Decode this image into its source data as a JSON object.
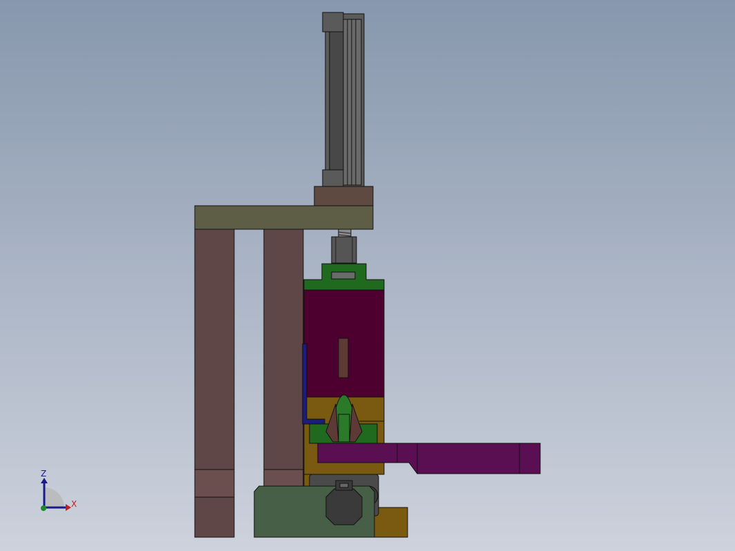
{
  "viewport": {
    "background_top": "#8797ad",
    "background_bottom": "#cdd2dc"
  },
  "triad": {
    "z_label": "Z",
    "x_label": "X",
    "z_color": "#1a1a8c",
    "x_color": "#c02020",
    "y_color": "#1f8a2a"
  },
  "parts": {
    "cylinder_color": "#5d5d5d",
    "top_plate_color": "#5e5e46",
    "pillar_color": "#5e4746",
    "upper_block_color": "#4d0030",
    "green_cap_color": "#1f6a1f",
    "lower_body_color": "#7a5a10",
    "arm_color": "#5a0f52",
    "base_block_color": "#465f46",
    "motor_color": "#3a3a3a",
    "bracket_color": "#1c1c7a"
  }
}
